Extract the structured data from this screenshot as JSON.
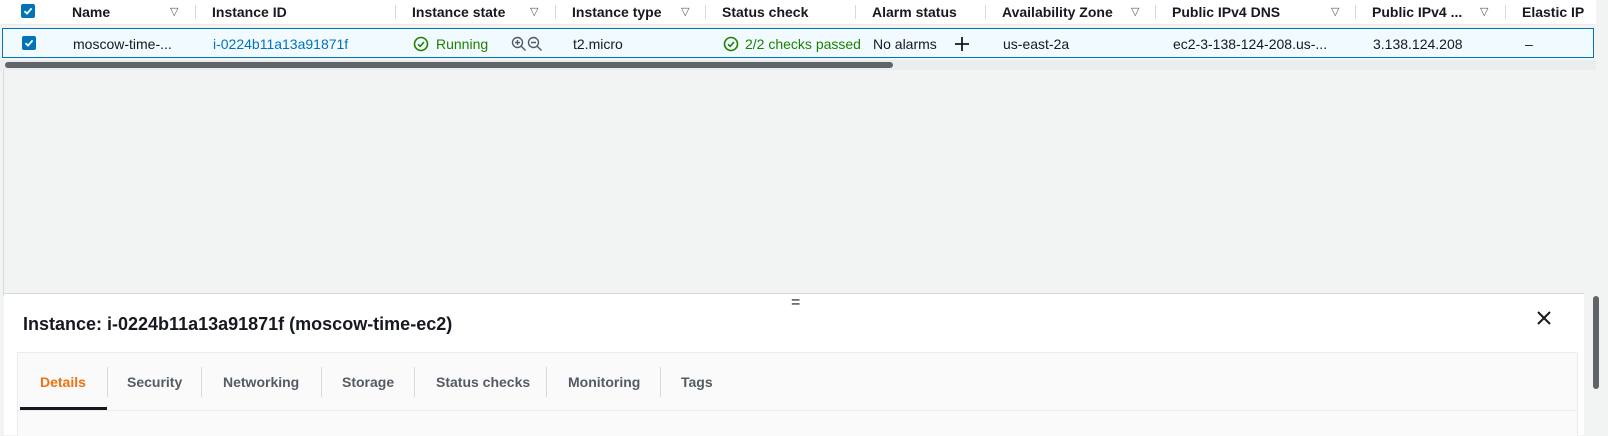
{
  "table": {
    "columns": [
      {
        "label": "Name"
      },
      {
        "label": "Instance ID"
      },
      {
        "label": "Instance state"
      },
      {
        "label": "Instance type"
      },
      {
        "label": "Status check"
      },
      {
        "label": "Alarm status"
      },
      {
        "label": "Availability Zone"
      },
      {
        "label": "Public IPv4 DNS"
      },
      {
        "label": "Public IPv4 ..."
      },
      {
        "label": "Elastic IP"
      }
    ],
    "row": {
      "selected": true,
      "name": "moscow-time-...",
      "instance_id": "i-0224b11a13a91871f",
      "state": "Running",
      "type": "t2.micro",
      "status_check": "2/2 checks passed",
      "alarm_status": "No alarms",
      "availability_zone": "us-east-2a",
      "public_dns": "ec2-3-138-124-208.us-...",
      "public_ip": "3.138.124.208",
      "elastic_ip": "–"
    }
  },
  "panel": {
    "title": "Instance: i-0224b11a13a91871f (moscow-time-ec2)",
    "drag_handle": "=",
    "tabs": [
      {
        "label": "Details",
        "active": true
      },
      {
        "label": "Security"
      },
      {
        "label": "Networking"
      },
      {
        "label": "Storage"
      },
      {
        "label": "Status checks"
      },
      {
        "label": "Monitoring"
      },
      {
        "label": "Tags"
      }
    ]
  },
  "colors": {
    "accent": "#0073bb",
    "running": "#1d8102",
    "active_tab": "#ec7211"
  },
  "icons": {
    "select_all": "checkbox-checked-icon",
    "state": "check-circle-icon",
    "zoom_in": "zoom-in-icon",
    "zoom_out": "zoom-out-icon",
    "add_alarm": "plus-icon",
    "close": "close-icon"
  }
}
